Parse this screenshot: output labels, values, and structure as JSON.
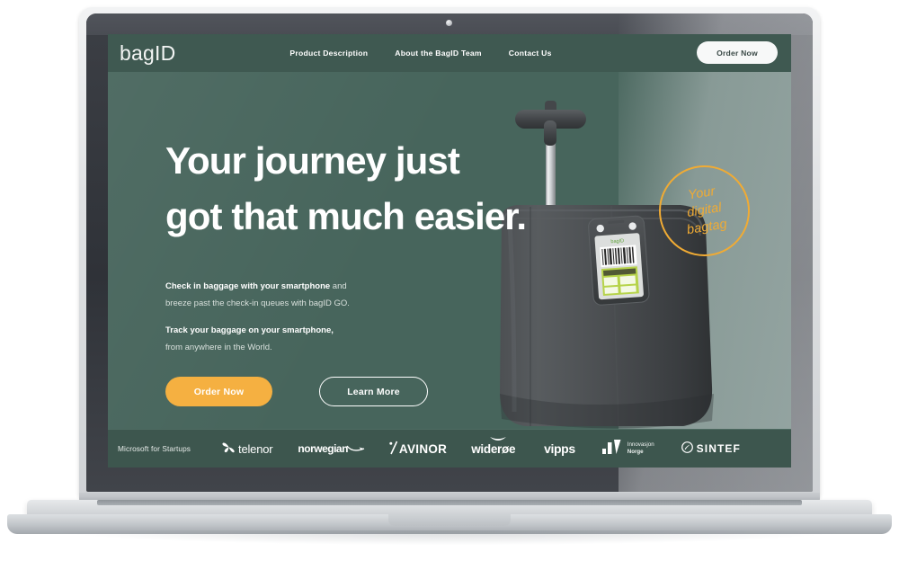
{
  "device": {
    "type": "laptop-mockup",
    "webcam": "webcam-dot"
  },
  "site": {
    "header": {
      "logo_text": "bagID",
      "nav": [
        {
          "label": "Product Description"
        },
        {
          "label": "About the BagID Team"
        },
        {
          "label": "Contact Us"
        }
      ],
      "cta_label": "Order Now"
    },
    "hero": {
      "headline_line1": "Your journey just",
      "headline_line2": "got that much easier.",
      "paragraphs": [
        {
          "strong": "Check in baggage with your smartphone",
          "rest": " and",
          "second_line": "breeze past the check-in queues with bagID GO."
        },
        {
          "strong": "Track your baggage on your smartphone,",
          "rest": "",
          "second_line": "from anywhere in the World."
        }
      ],
      "primary_cta": "Order Now",
      "secondary_cta": "Learn More",
      "badge": {
        "line1": "Your",
        "line2": "digital",
        "line3": "bagtag"
      }
    },
    "partners": [
      {
        "name": "Microsoft for Startups"
      },
      {
        "name": "telenor"
      },
      {
        "name": "norwegian"
      },
      {
        "name": "AVINOR"
      },
      {
        "name": "widerøe"
      },
      {
        "name": "vipps"
      },
      {
        "name": "Innovasjon",
        "name2": "Norge"
      },
      {
        "name": "SINTEF"
      }
    ]
  },
  "colors": {
    "screen_green": "#47655C",
    "header_green": "#3F5951",
    "strip_green": "#3D564E",
    "accent_orange": "#F5B041",
    "badge_orange": "#F0AB34",
    "text_white": "#FFFFFF",
    "text_muted": "#D8E0DC"
  }
}
